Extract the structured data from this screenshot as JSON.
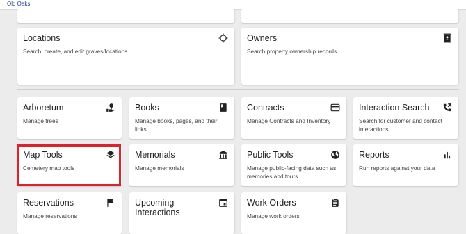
{
  "app": {
    "title": "Old Oaks"
  },
  "cards": {
    "locations": {
      "title": "Locations",
      "desc": "Search, create, and edit graves/locations",
      "icon": "crosshair-icon"
    },
    "owners": {
      "title": "Owners",
      "desc": "Search property ownership records",
      "icon": "contact-book-icon"
    },
    "arboretum": {
      "title": "Arboretum",
      "desc": "Manage trees",
      "icon": "tree-hand-icon"
    },
    "books": {
      "title": "Books",
      "desc": "Manage books, pages, and their links",
      "icon": "book-icon"
    },
    "contracts": {
      "title": "Contracts",
      "desc": "Manage Contracts and Inventory",
      "icon": "credit-card-icon"
    },
    "interaction": {
      "title": "Interaction Search",
      "desc": "Search for customer and contact interactions",
      "icon": "phone-call-icon"
    },
    "maptools": {
      "title": "Map Tools",
      "desc": "Cemetery map tools",
      "icon": "layers-icon"
    },
    "memorials": {
      "title": "Memorials",
      "desc": "Manage memorials",
      "icon": "museum-icon"
    },
    "publictools": {
      "title": "Public Tools",
      "desc": "Manage public-facing data such as memories and tours",
      "icon": "globe-icon"
    },
    "reports": {
      "title": "Reports",
      "desc": "Run reports against your data",
      "icon": "bar-chart-icon"
    },
    "reservations": {
      "title": "Reservations",
      "desc": "Manage reservations",
      "icon": "flag-icon"
    },
    "upcoming": {
      "title": "Upcoming",
      "desc": "Interactions",
      "icon": "calendar-icon"
    },
    "workorders": {
      "title": "Work Orders",
      "desc": "Manage work orders",
      "icon": "clipboard-icon"
    }
  },
  "colors": {
    "highlight": "#e0202b",
    "background": "#ececec",
    "card": "#ffffff"
  }
}
